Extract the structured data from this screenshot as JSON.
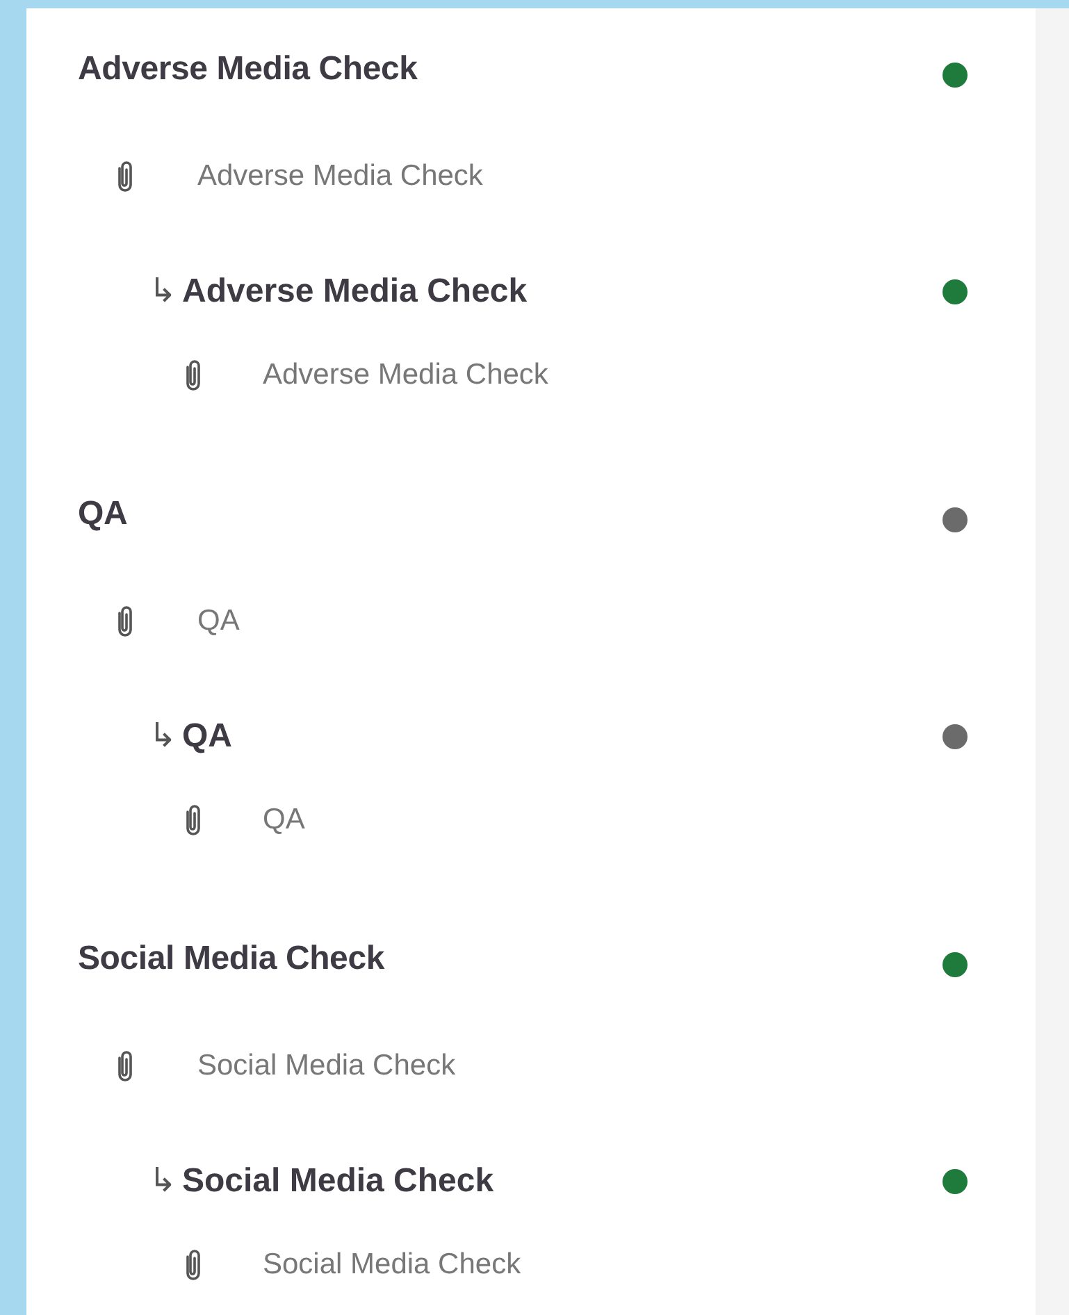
{
  "sections": [
    {
      "title": "Adverse Media Check",
      "color": "#1e7b3c",
      "attachment": "Adverse Media Check",
      "children": [
        {
          "arrow": "↳",
          "title": "Adverse Media Check",
          "color": "#1e7b3c",
          "attachment": "Adverse Media Check"
        }
      ]
    },
    {
      "title": "QA",
      "color": "#6b6b6b",
      "attachment": "QA",
      "children": [
        {
          "arrow": "↳",
          "title": "QA",
          "color": "#6b6b6b",
          "attachment": "QA"
        }
      ]
    },
    {
      "title": "Social Media Check",
      "color": "#1e7b3c",
      "attachment": "Social Media Check",
      "children": [
        {
          "arrow": "↳",
          "title": "Social Media Check",
          "color": "#1e7b3c",
          "attachment": "Social Media Check"
        }
      ]
    }
  ]
}
